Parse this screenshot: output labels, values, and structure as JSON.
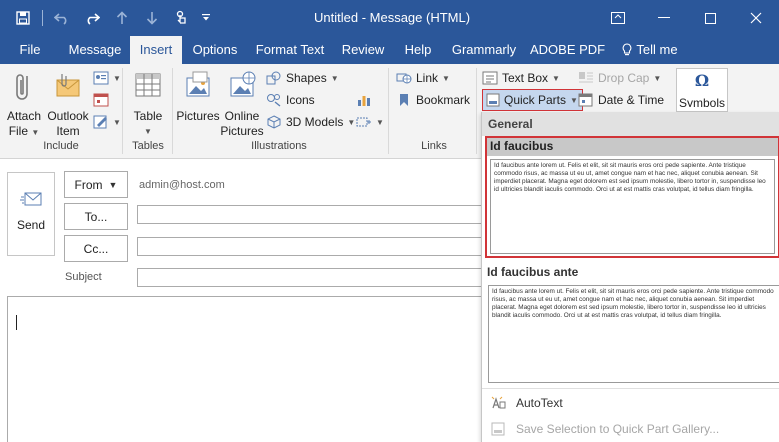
{
  "window": {
    "title": "Untitled  -  Message (HTML)"
  },
  "tabs": [
    {
      "label": "File"
    },
    {
      "label": "Message"
    },
    {
      "label": "Insert"
    },
    {
      "label": "Options"
    },
    {
      "label": "Format Text"
    },
    {
      "label": "Review"
    },
    {
      "label": "Help"
    },
    {
      "label": "Grammarly"
    },
    {
      "label": "ADOBE PDF"
    },
    {
      "label": "Tell me"
    }
  ],
  "ribbon": {
    "include": {
      "attach_file": "Attach\nFile",
      "attach_file_l1": "Attach",
      "attach_file_l2": "File",
      "outlook_item_l1": "Outlook",
      "outlook_item_l2": "Item",
      "label": "Include"
    },
    "tables": {
      "table": "Table",
      "label": "Tables"
    },
    "illustrations": {
      "pictures": "Pictures",
      "online_pictures_l1": "Online",
      "online_pictures_l2": "Pictures",
      "shapes": "Shapes",
      "icons": "Icons",
      "models": "3D Models",
      "label": "Illustrations"
    },
    "links": {
      "link": "Link",
      "bookmark": "Bookmark",
      "label": "Links"
    },
    "text": {
      "text_box": "Text Box",
      "drop_cap": "Drop Cap",
      "quick_parts": "Quick Parts",
      "date_time": "Date & Time",
      "symbols": "Symbols"
    }
  },
  "compose": {
    "send": "Send",
    "from": "From",
    "from_value": "admin@host.com",
    "to": "To...",
    "cc": "Cc...",
    "subject": "Subject"
  },
  "quick_parts_menu": {
    "section": "General",
    "items": [
      {
        "title": "Id faucibus",
        "preview": "Id faucibus ante lorem ut. Felis et elit, sit sit mauris eros orci pede sapiente. Ante tristique commodo risus, ac massa ut eu ut, amet congue nam et hac nec, aliquet conubia aenean. Sit imperdiet placerat. Magna eget dolorem est sed ipsum molestie, libero tortor in, suspendisse leo id ultricies blandit iaculis commodo. Orci ut at est mattis cras volutpat, id tellus diam fringilla."
      },
      {
        "title": "Id faucibus ante",
        "preview": "Id faucibus ante lorem ut. Felis et elit, sit sit mauris eros orci pede sapiente. Ante tristique commodo risus, ac massa ut eu ut, amet congue nam et hac nec, aliquet conubia aenean. Sit imperdiet placerat. Magna eget dolorem est sed ipsum molestie, libero tortor in, suspendisse leo id ultricies blandit iaculis commodo. Orci ut at est mattis cras volutpat, id tellus diam fringilla."
      }
    ],
    "autotext": "AutoText",
    "save_selection": "Save Selection to Quick Part Gallery..."
  }
}
